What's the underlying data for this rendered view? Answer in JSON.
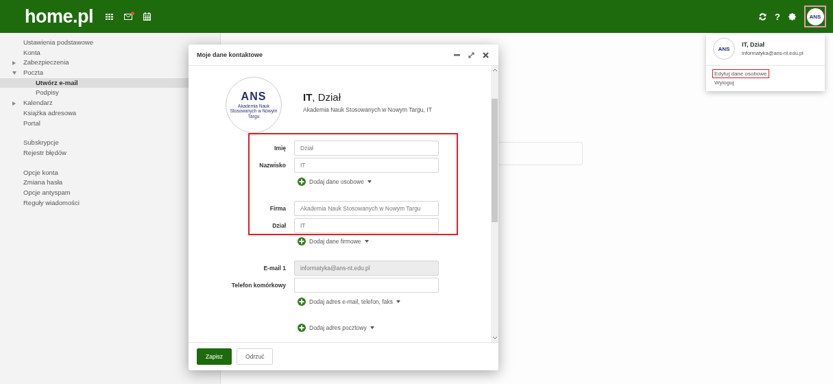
{
  "topbar": {
    "logo": "home.pl",
    "apps": [
      {
        "kind": "grid"
      },
      {
        "kind": "mail",
        "notification": true
      },
      {
        "kind": "calendar"
      }
    ],
    "tools": [
      {
        "kind": "refresh"
      },
      {
        "kind": "help",
        "label": "?"
      },
      {
        "kind": "settings"
      }
    ],
    "avatar": {
      "text": "ANS",
      "highlighted": true
    }
  },
  "sidebar": {
    "groups": [
      [
        {
          "label": "Ustawienia podstawowe",
          "selected": false
        },
        {
          "label": "Konta",
          "selected": false
        },
        {
          "label": "Zabezpieczenia",
          "selected": false,
          "expanded": false
        },
        {
          "label": "Poczta",
          "selected": false,
          "expanded": true,
          "children": [
            {
              "label": "Utwórz e-mail",
              "selected": true
            },
            {
              "label": "Podpisy",
              "selected": false
            }
          ]
        },
        {
          "label": "Kalendarz",
          "selected": false,
          "expanded": false
        },
        {
          "label": "Książka adresowa",
          "selected": false
        },
        {
          "label": "Portal",
          "selected": false
        }
      ],
      [
        {
          "label": "Subskrypcje",
          "selected": false
        },
        {
          "label": "Rejestr błędów",
          "selected": false
        }
      ],
      [
        {
          "label": "Opcje konta",
          "selected": false
        },
        {
          "label": "Zmiana hasła",
          "selected": false
        },
        {
          "label": "Opcje antyspam",
          "selected": false
        },
        {
          "label": "Reguły wiadomości",
          "selected": false
        }
      ]
    ]
  },
  "dialog": {
    "title": "Moje dane kontaktowe",
    "logo": {
      "text": "ANS",
      "caption": "Akademia Nauk Stosowanych w Nowym Targu"
    },
    "name": "**IT**, Dział",
    "subtitle": "Akademia Nauk Stosowanych w Nowym Targu, IT",
    "blocks": [
      {
        "highlighted": true,
        "rows": [
          {
            "kind": "field",
            "label": "Imię",
            "value": "Dział",
            "disabled": false
          },
          {
            "kind": "field",
            "label": "Nazwisko",
            "value": "IT",
            "disabled": false
          },
          {
            "kind": "add",
            "text": "Dodaj dane osobowe"
          },
          {
            "kind": "field",
            "label": "Firma",
            "value": "Akademia Nauk Stosowanych w Nowym Targu",
            "disabled": false
          },
          {
            "kind": "field",
            "label": "Dział",
            "value": "IT",
            "disabled": false
          }
        ]
      },
      {
        "highlighted": false,
        "rows": [
          {
            "kind": "add",
            "text": "Dodaj dane firmowe"
          },
          {
            "kind": "field",
            "label": "E-mail 1",
            "value": "informatyka@ans-nt.edu.pl",
            "disabled": true
          },
          {
            "kind": "field",
            "label": "Telefon komórkowy",
            "disabled": false
          },
          {
            "kind": "add",
            "text": "Dodaj adres e-mail, telefon, faks"
          },
          {
            "kind": "add",
            "text": "Dodaj adres pocztowy"
          }
        ]
      }
    ],
    "buttons": [
      {
        "label": "Zapisz",
        "kind": "primary"
      },
      {
        "label": "Odrzuć",
        "kind": "secondary"
      }
    ]
  },
  "account_menu": {
    "name": "IT, Dział",
    "email": "informatyka@ans-nt.edu.pl",
    "logo": "ANS",
    "items": [
      {
        "label": "Edytuj dane osobowe",
        "highlighted": true
      },
      {
        "label": "Wyloguj",
        "highlighted": false
      }
    ]
  }
}
